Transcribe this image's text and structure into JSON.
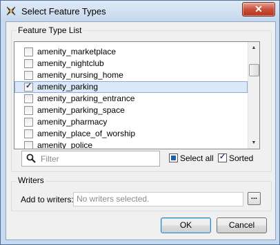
{
  "window": {
    "title": "Select Feature Types",
    "close_label": "✕"
  },
  "feature_type_list": {
    "group_title": "Feature Type List",
    "items": [
      {
        "label": "amenity_marketplace",
        "checked": false,
        "selected": false
      },
      {
        "label": "amenity_nightclub",
        "checked": false,
        "selected": false
      },
      {
        "label": "amenity_nursing_home",
        "checked": false,
        "selected": false
      },
      {
        "label": "amenity_parking",
        "checked": true,
        "selected": true
      },
      {
        "label": "amenity_parking_entrance",
        "checked": false,
        "selected": false
      },
      {
        "label": "amenity_parking_space",
        "checked": false,
        "selected": false
      },
      {
        "label": "amenity_pharmacy",
        "checked": false,
        "selected": false
      },
      {
        "label": "amenity_place_of_worship",
        "checked": false,
        "selected": false
      },
      {
        "label": "amenity_police",
        "checked": false,
        "selected": false
      }
    ],
    "filter_placeholder": "Filter",
    "filter_value": "",
    "select_all_label": "Select all",
    "select_all_state": "partial",
    "sorted_label": "Sorted",
    "sorted_checked": true
  },
  "writers": {
    "group_title": "Writers",
    "add_label": "Add to writers:",
    "field_value": "No writers selected.",
    "browse_label": "..."
  },
  "buttons": {
    "ok_label": "OK",
    "cancel_label": "Cancel"
  },
  "icons": {
    "app": "fme-feature-icon",
    "close": "close-icon",
    "filter": "search-icon"
  }
}
